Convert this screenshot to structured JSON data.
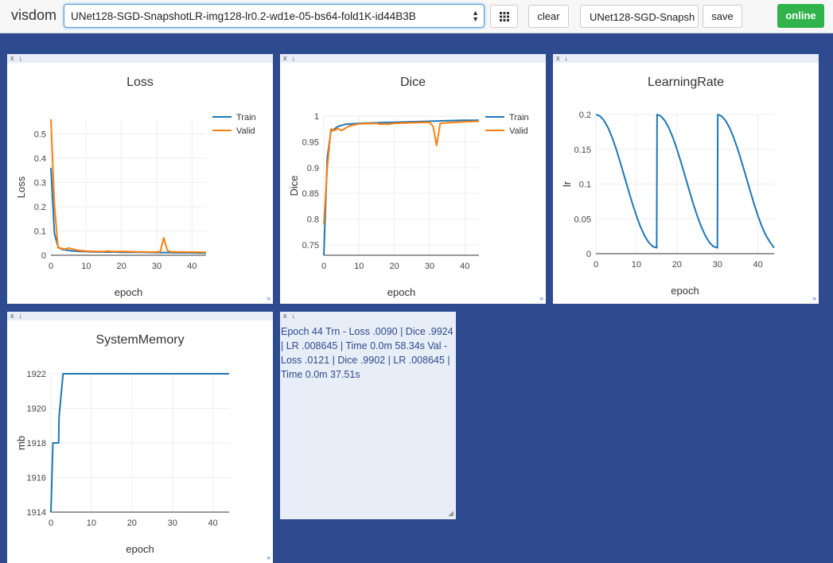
{
  "app": {
    "title": "visdom"
  },
  "toolbar": {
    "env_value": "UNet128-SGD-SnapshotLR-img128-lr0.2-wd1e-05-bs64-fold1K-id44B3B",
    "grid_icon": "grid-icon",
    "clear_label": "clear",
    "name_value": "UNet128-SGD-Snapsh",
    "save_label": "save",
    "status_label": "online",
    "status_color": "#2fb34a"
  },
  "pane_controls": {
    "close": "x",
    "download": "↓",
    "resize": "»"
  },
  "charts": {
    "loss": {
      "type": "line",
      "title": "Loss",
      "xlabel": "epoch",
      "ylabel": "Loss",
      "xlim": [
        0,
        44
      ],
      "ylim": [
        0,
        0.56
      ],
      "xticks": [
        0,
        10,
        20,
        30,
        40
      ],
      "yticks": [
        0,
        0.1,
        0.2,
        0.3,
        0.4,
        0.5
      ],
      "ytick_labels": [
        "0",
        "0.1",
        "0.2",
        "0.3",
        "0.4",
        "0.5"
      ],
      "series": [
        {
          "name": "Train",
          "color": "#1f77b4",
          "x": [
            0,
            1,
            2,
            3,
            4,
            5,
            6,
            8,
            10,
            12,
            15,
            18,
            20,
            25,
            30,
            31,
            32,
            33,
            35,
            40,
            44
          ],
          "y": [
            0.36,
            0.09,
            0.035,
            0.025,
            0.022,
            0.02,
            0.018,
            0.016,
            0.015,
            0.014,
            0.013,
            0.013,
            0.012,
            0.012,
            0.011,
            0.011,
            0.011,
            0.011,
            0.01,
            0.01,
            0.009
          ]
        },
        {
          "name": "Valid",
          "color": "#ff7f0e",
          "x": [
            0,
            1,
            2,
            3,
            4,
            5,
            6,
            7,
            8,
            10,
            12,
            15,
            16,
            17,
            18,
            20,
            25,
            30,
            31,
            32,
            33,
            34,
            35,
            40,
            44
          ],
          "y": [
            0.56,
            0.21,
            0.03,
            0.028,
            0.025,
            0.03,
            0.026,
            0.022,
            0.02,
            0.017,
            0.016,
            0.015,
            0.017,
            0.016,
            0.015,
            0.016,
            0.014,
            0.013,
            0.015,
            0.072,
            0.02,
            0.014,
            0.014,
            0.013,
            0.012
          ]
        }
      ]
    },
    "dice": {
      "type": "line",
      "title": "Dice",
      "xlabel": "epoch",
      "ylabel": "Dice",
      "xlim": [
        0,
        44
      ],
      "ylim": [
        0.73,
        1.0
      ],
      "xticks": [
        0,
        10,
        20,
        30,
        40
      ],
      "yticks": [
        0.75,
        0.8,
        0.85,
        0.9,
        0.95,
        1
      ],
      "ytick_labels": [
        "0.75",
        "0.8",
        "0.85",
        "0.9",
        "0.95",
        "1"
      ],
      "series": [
        {
          "name": "Train",
          "color": "#1f77b4",
          "x": [
            0,
            1,
            2,
            3,
            4,
            5,
            6,
            8,
            10,
            15,
            20,
            25,
            30,
            35,
            40,
            44
          ],
          "y": [
            0.73,
            0.92,
            0.97,
            0.975,
            0.98,
            0.982,
            0.984,
            0.985,
            0.986,
            0.987,
            0.988,
            0.989,
            0.99,
            0.991,
            0.992,
            0.992
          ]
        },
        {
          "name": "Valid",
          "color": "#ff7f0e",
          "x": [
            0,
            1,
            2,
            3,
            4,
            5,
            6,
            7,
            8,
            10,
            15,
            16,
            17,
            18,
            20,
            25,
            30,
            31,
            32,
            33,
            35,
            40,
            44
          ],
          "y": [
            0.79,
            0.9,
            0.975,
            0.972,
            0.976,
            0.972,
            0.976,
            0.98,
            0.982,
            0.985,
            0.986,
            0.984,
            0.985,
            0.984,
            0.986,
            0.987,
            0.988,
            0.98,
            0.943,
            0.986,
            0.987,
            0.989,
            0.99
          ]
        }
      ]
    },
    "lr": {
      "type": "line",
      "title": "LearningRate",
      "xlabel": "epoch",
      "ylabel": "lr",
      "xlim": [
        0,
        44
      ],
      "ylim": [
        0,
        0.2
      ],
      "xticks": [
        0,
        10,
        20,
        30,
        40
      ],
      "yticks": [
        0,
        0.05,
        0.1,
        0.15,
        0.2
      ],
      "ytick_labels": [
        "0",
        "0.05",
        "0.1",
        "0.15",
        "0.2"
      ],
      "series": [
        {
          "name": "lr",
          "color": "#1f77b4",
          "x": [
            0,
            1,
            2,
            3,
            4,
            5,
            6,
            7,
            8,
            9,
            10,
            11,
            12,
            13,
            14,
            15,
            15.1,
            16,
            17,
            18,
            19,
            20,
            21,
            22,
            23,
            24,
            25,
            26,
            27,
            28,
            29,
            30,
            30.1,
            31,
            32,
            33,
            34,
            35,
            36,
            37,
            38,
            39,
            40,
            41,
            42,
            43,
            44
          ],
          "y": [
            0.2,
            0.1978,
            0.1914,
            0.181,
            0.167,
            0.1503,
            0.1316,
            0.1118,
            0.0918,
            0.0724,
            0.0545,
            0.0388,
            0.0259,
            0.0163,
            0.0104,
            0.0085,
            0.2,
            0.1978,
            0.1914,
            0.181,
            0.167,
            0.1503,
            0.1316,
            0.1118,
            0.0918,
            0.0724,
            0.0545,
            0.0388,
            0.0259,
            0.0163,
            0.0104,
            0.0085,
            0.2,
            0.1978,
            0.1914,
            0.181,
            0.167,
            0.1503,
            0.1316,
            0.1118,
            0.0918,
            0.0724,
            0.0545,
            0.0388,
            0.0259,
            0.0163,
            0.0086
          ]
        }
      ]
    },
    "mem": {
      "type": "line",
      "title": "SystemMemory",
      "xlabel": "epoch",
      "ylabel": "mb",
      "xlim": [
        0,
        44
      ],
      "ylim": [
        1914,
        1922
      ],
      "xticks": [
        0,
        10,
        20,
        30,
        40
      ],
      "yticks": [
        1914,
        1916,
        1918,
        1920,
        1922
      ],
      "ytick_labels": [
        "1914",
        "1916",
        "1918",
        "1920",
        "1922"
      ],
      "series": [
        {
          "name": "mb",
          "color": "#1f77b4",
          "x": [
            0,
            0.5,
            1,
            1.9,
            2,
            3,
            44
          ],
          "y": [
            1914,
            1918,
            1918,
            1918,
            1919.5,
            1922,
            1922
          ]
        }
      ]
    }
  },
  "text_pane": {
    "content": "Epoch 44 Trn - Loss .0090 | Dice .9924 | LR .008645 | Time 0.0m 58.34s Val - Loss .0121 | Dice .9902 | LR .008645 | Time 0.0m 37.51s"
  }
}
